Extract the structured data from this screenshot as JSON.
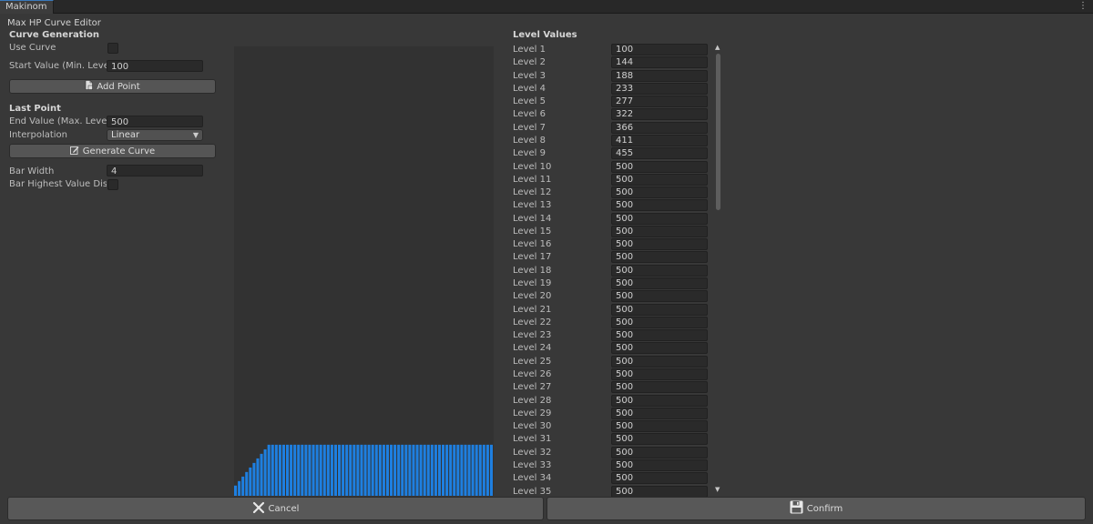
{
  "tab": {
    "title": "Makinom"
  },
  "editor": {
    "title": "Max HP Curve Editor"
  },
  "curve_generation": {
    "header": "Curve Generation",
    "use_curve_label": "Use Curve",
    "use_curve_checked": false,
    "start_value_label": "Start Value (Min. Level)",
    "start_value": "100",
    "add_point_label": "Add Point"
  },
  "last_point": {
    "header": "Last Point",
    "end_value_label": "End Value (Max. Level)",
    "end_value": "500",
    "interpolation_label": "Interpolation",
    "interpolation_value": "Linear",
    "generate_label": "Generate Curve"
  },
  "display": {
    "bar_width_label": "Bar Width",
    "bar_width": "4",
    "bar_highest_label": "Bar Highest Value Display",
    "bar_highest_checked": false
  },
  "levels": {
    "header": "Level Values",
    "rows": [
      {
        "label": "Level 1",
        "value": "100"
      },
      {
        "label": "Level 2",
        "value": "144"
      },
      {
        "label": "Level 3",
        "value": "188"
      },
      {
        "label": "Level 4",
        "value": "233"
      },
      {
        "label": "Level 5",
        "value": "277"
      },
      {
        "label": "Level 6",
        "value": "322"
      },
      {
        "label": "Level 7",
        "value": "366"
      },
      {
        "label": "Level 8",
        "value": "411"
      },
      {
        "label": "Level 9",
        "value": "455"
      },
      {
        "label": "Level 10",
        "value": "500"
      },
      {
        "label": "Level 11",
        "value": "500"
      },
      {
        "label": "Level 12",
        "value": "500"
      },
      {
        "label": "Level 13",
        "value": "500"
      },
      {
        "label": "Level 14",
        "value": "500"
      },
      {
        "label": "Level 15",
        "value": "500"
      },
      {
        "label": "Level 16",
        "value": "500"
      },
      {
        "label": "Level 17",
        "value": "500"
      },
      {
        "label": "Level 18",
        "value": "500"
      },
      {
        "label": "Level 19",
        "value": "500"
      },
      {
        "label": "Level 20",
        "value": "500"
      },
      {
        "label": "Level 21",
        "value": "500"
      },
      {
        "label": "Level 22",
        "value": "500"
      },
      {
        "label": "Level 23",
        "value": "500"
      },
      {
        "label": "Level 24",
        "value": "500"
      },
      {
        "label": "Level 25",
        "value": "500"
      },
      {
        "label": "Level 26",
        "value": "500"
      },
      {
        "label": "Level 27",
        "value": "500"
      },
      {
        "label": "Level 28",
        "value": "500"
      },
      {
        "label": "Level 29",
        "value": "500"
      },
      {
        "label": "Level 30",
        "value": "500"
      },
      {
        "label": "Level 31",
        "value": "500"
      },
      {
        "label": "Level 32",
        "value": "500"
      },
      {
        "label": "Level 33",
        "value": "500"
      },
      {
        "label": "Level 34",
        "value": "500"
      },
      {
        "label": "Level 35",
        "value": "500"
      }
    ]
  },
  "curve_preview": {
    "bar_color": "#1e7fe0",
    "value_max": 4400,
    "values": [
      100,
      144,
      188,
      233,
      277,
      322,
      366,
      411,
      455,
      500,
      500,
      500,
      500,
      500,
      500,
      500,
      500,
      500,
      500,
      500,
      500,
      500,
      500,
      500,
      500,
      500,
      500,
      500,
      500,
      500,
      500,
      500,
      500,
      500,
      500,
      500,
      500,
      500,
      500,
      500,
      500,
      500,
      500,
      500,
      500,
      500,
      500,
      500,
      500,
      500,
      500,
      500,
      500,
      500,
      500,
      500,
      500,
      500,
      500,
      500,
      500,
      500,
      500,
      500,
      500,
      500,
      500,
      500,
      500,
      500
    ]
  },
  "footer": {
    "cancel_label": "Cancel",
    "confirm_label": "Confirm"
  },
  "icons": {
    "cancel": "close-icon",
    "confirm": "save-icon",
    "add_point": "add-document-icon",
    "generate": "edit-icon",
    "menu": "more-vertical-icon"
  }
}
